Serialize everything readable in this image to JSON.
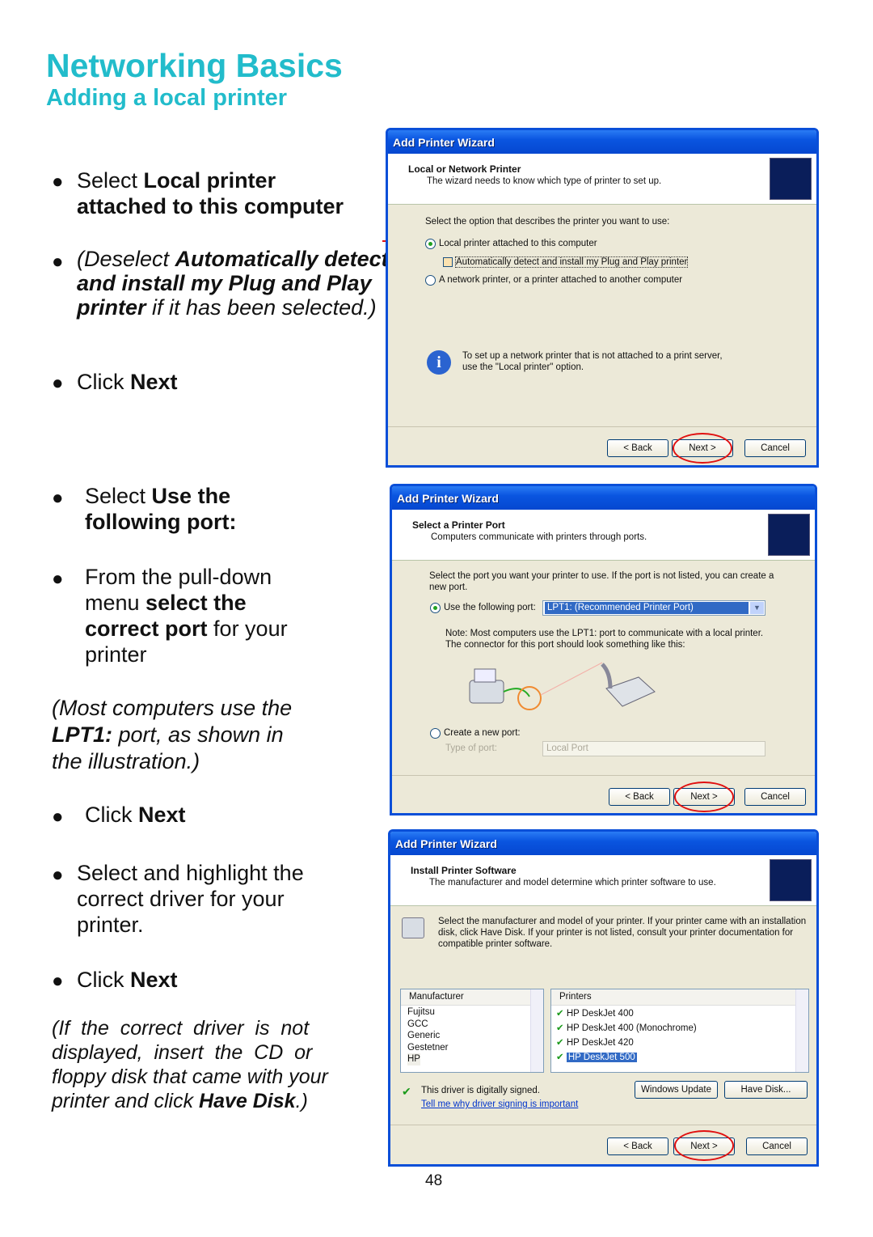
{
  "heading": {
    "title": "Networking Basics",
    "subtitle": "Adding a local printer"
  },
  "left": {
    "s1": [
      "Select ",
      "Local printer",
      "attached to this computer"
    ],
    "s2": [
      "(Deselect ",
      "Automatically detect",
      "and install my Plug and Play",
      "printer",
      " if it has been selected.)"
    ],
    "click_next": [
      "Click ",
      "Next"
    ],
    "s3": [
      "Select ",
      "Use the",
      "following port:"
    ],
    "s4": [
      "From the pull-down",
      "menu ",
      "select the",
      "correct port",
      " for your",
      "printer"
    ],
    "s5": [
      "(Most computers use the",
      "LPT1:",
      " port, as shown in",
      "the illustration.)"
    ],
    "s6": [
      "Select and highlight the",
      "correct driver for your",
      "printer."
    ],
    "s7": [
      "(If  the  correct  driver  is  not",
      "displayed,  insert  the  CD  or",
      "floppy disk that came with your",
      "printer and click ",
      "Have Disk",
      ".)"
    ]
  },
  "wizard_title": "Add Printer Wizard",
  "buttons": {
    "back": "< Back",
    "next": "Next >",
    "cancel": "Cancel"
  },
  "dialog1": {
    "header": "Local or Network Printer",
    "subheader": "The wizard needs to know which type of printer to set up.",
    "prompt": "Select the option that describes the printer you want to use:",
    "opt_local": "Local printer attached to this computer",
    "opt_auto": "Automatically detect and install my Plug and Play printer",
    "opt_network": "A network printer, or a printer attached to another computer",
    "info": "To set up a network printer that is not attached to a print server,",
    "info2": "use the \"Local printer\" option."
  },
  "dialog2": {
    "header": "Select a Printer Port",
    "subheader": "Computers communicate with printers through ports.",
    "prompt": "Select the port you want your printer to use.  If the port is not listed, you can create a",
    "prompt2": "new port.",
    "opt_use": "Use the following port:",
    "port_value": "LPT1: (Recommended Printer Port)",
    "note": "Note: Most computers use the LPT1: port to communicate with a local printer.",
    "note2": "The connector for this port should look something like this:",
    "opt_create": "Create a new port:",
    "type_label": "Type of port:",
    "type_value": "Local Port"
  },
  "dialog3": {
    "header": "Install Printer Software",
    "subheader": "The manufacturer and model determine which printer software to use.",
    "desc": "Select the manufacturer and model of your printer. If your printer came with an installation",
    "desc2": "disk, click Have Disk. If your printer is not listed, consult your printer documentation for",
    "desc3": "compatible printer software.",
    "manufacturer_header": "Manufacturer",
    "manufacturers": [
      "Fujitsu",
      "GCC",
      "Generic",
      "Gestetner",
      "HP"
    ],
    "printers_header": "Printers",
    "printers": [
      "HP DeskJet 400",
      "HP DeskJet 400 (Monochrome)",
      "HP DeskJet 420",
      "HP DeskJet 500"
    ],
    "signed": "This driver is digitally signed.",
    "signing_link": "Tell me why driver signing is important",
    "windows_update": "Windows Update",
    "have_disk": "Have Disk..."
  },
  "page_number": "48",
  "colors": {
    "heading": "#22bccb",
    "titlebar": "#0a55e0",
    "highlight": "#e01010"
  }
}
